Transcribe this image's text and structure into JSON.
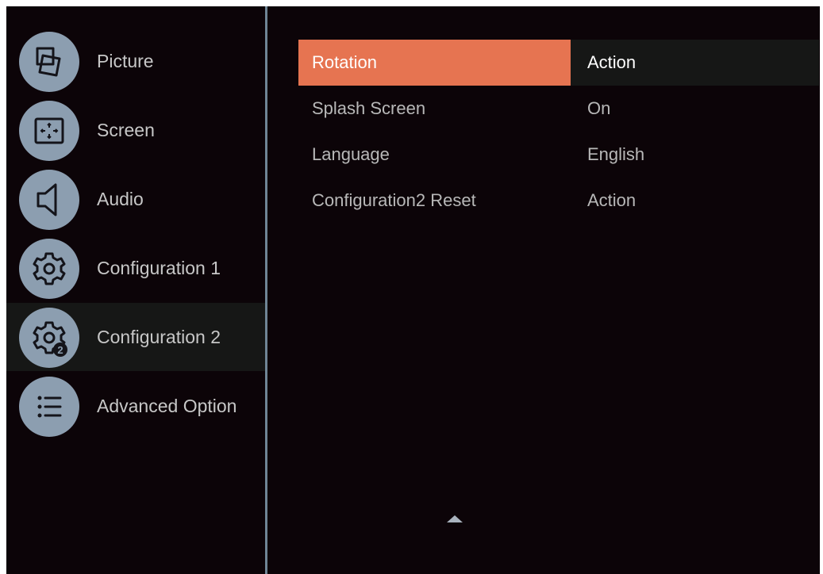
{
  "sidebar": {
    "items": [
      {
        "label": "Picture",
        "icon": "picture-icon",
        "selected": false
      },
      {
        "label": "Screen",
        "icon": "screen-icon",
        "selected": false
      },
      {
        "label": "Audio",
        "icon": "audio-icon",
        "selected": false
      },
      {
        "label": "Configuration 1",
        "icon": "gear-icon",
        "selected": false
      },
      {
        "label": "Configuration 2",
        "icon": "gear-2-icon",
        "selected": true
      },
      {
        "label": "Advanced Option",
        "icon": "list-icon",
        "selected": false
      }
    ]
  },
  "settings": {
    "rows": [
      {
        "label": "Rotation",
        "value": "Action",
        "highlighted": true
      },
      {
        "label": "Splash Screen",
        "value": "On",
        "highlighted": false
      },
      {
        "label": "Language",
        "value": "English",
        "highlighted": false
      },
      {
        "label": "Configuration2 Reset",
        "value": "Action",
        "highlighted": false
      }
    ]
  },
  "icons": {
    "scroll": "scroll-up-arrow-icon"
  },
  "colors": {
    "background": "#0c0408",
    "highlight": "#e67451",
    "icon_circle": "#8c9eb0",
    "divider": "#6f8595",
    "text": "#c7c7c7",
    "selected_row": "#161716"
  }
}
